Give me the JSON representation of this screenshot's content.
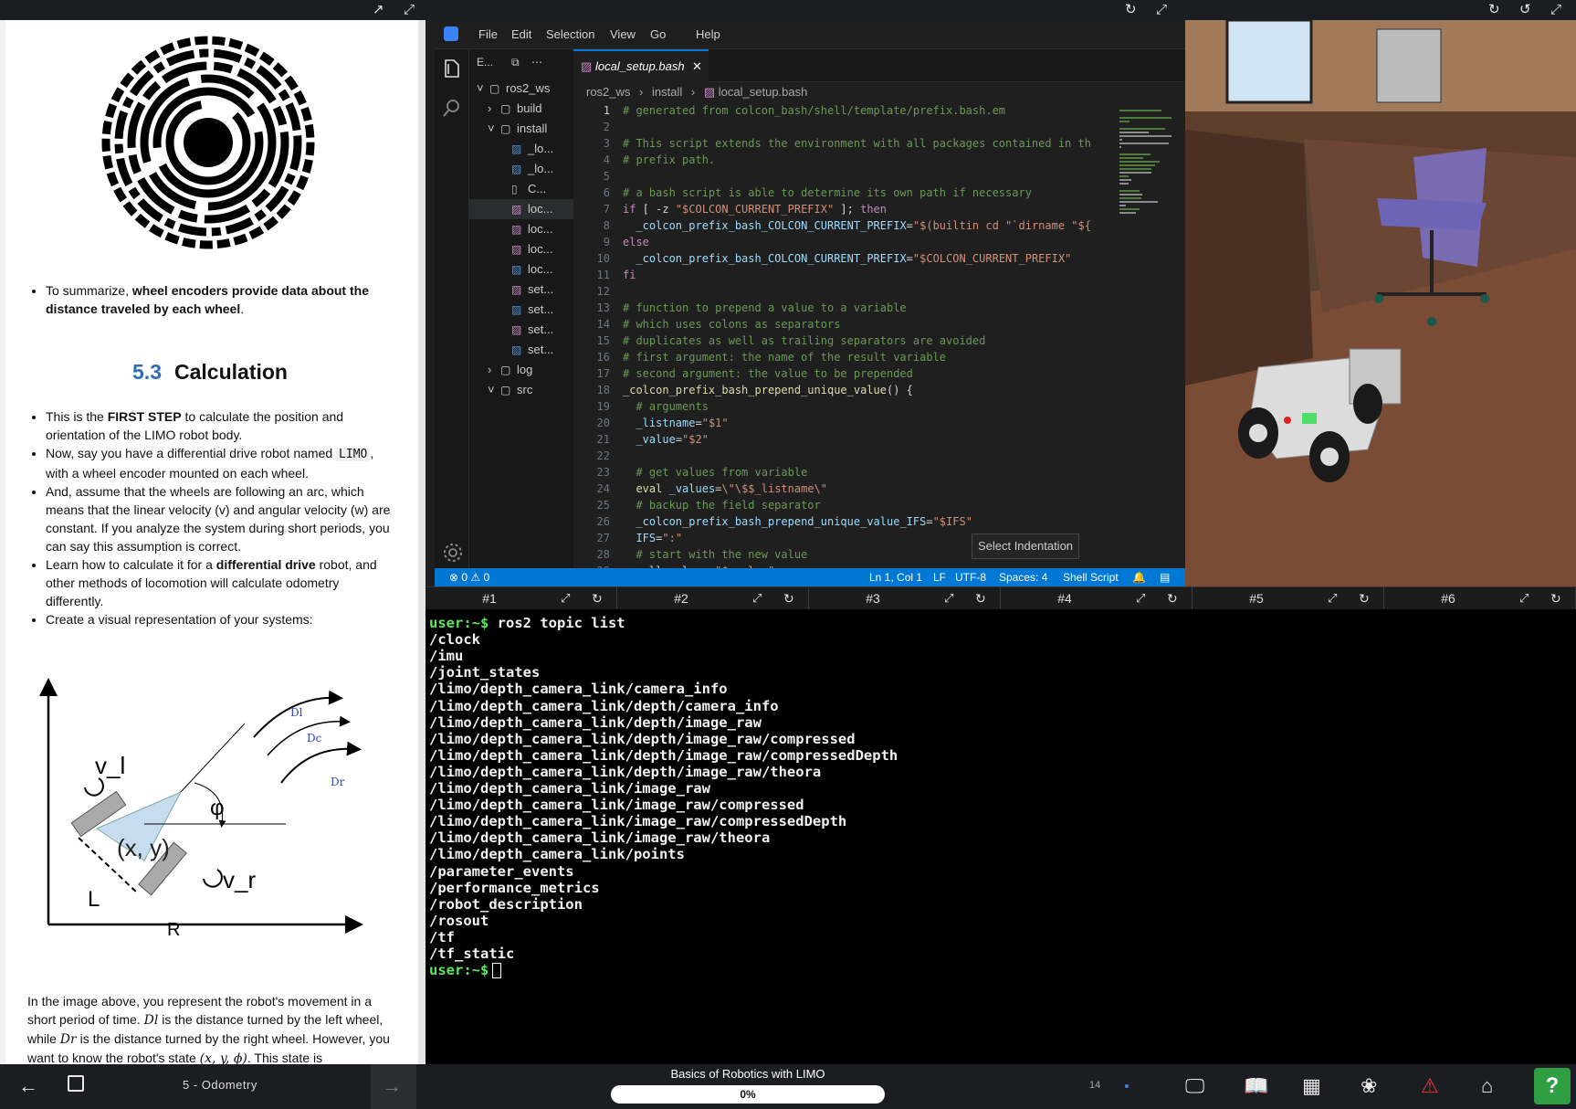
{
  "notebook": {
    "summary_bullet_prefix": "To summarize, ",
    "summary_bullet_bold": "wheel encoders provide data about the distance traveled by each wheel",
    "summary_bullet_suffix": ".",
    "section_number": "5.3",
    "section_title": "Calculation",
    "b1_prefix": "This is the ",
    "b1_bold": "FIRST STEP",
    "b1_suffix": " to calculate the position and orientation of the LIMO robot body.",
    "b2_prefix": "Now, say you have a differential drive robot named ",
    "b2_code": "LIMO",
    "b2_suffix": ", with a wheel encoder mounted on each wheel.",
    "b3": "And, assume that the wheels are following an arc, which means that the linear velocity (v) and angular velocity (w) are constant. If you analyze the system during short periods, you can say this assumption is correct.",
    "b4_prefix": "Learn how to calculate it for a ",
    "b4_bold": "differential drive",
    "b4_suffix": " robot, and other methods of locomotion will calculate odometry differently.",
    "b5": "Create a visual representation of your systems:",
    "diagram": {
      "v_l": "v_l",
      "v_r": "v_r",
      "xy": "(x, y)",
      "L": "L",
      "R": "R",
      "phi": "φ",
      "Dl": "Dl",
      "Dc": "Dc",
      "Dr": "Dr"
    },
    "para_1": "In the image above, you represent the robot's movement in a short period of time. ",
    "para_Dl": "Dl",
    "para_2": " is the distance turned by the left wheel, while ",
    "para_Dr": "Dr",
    "para_3": " is the distance turned by the right wheel. However, you want to know the robot's state ",
    "para_state": "(x, y, ϕ)",
    "para_4": ". This state is"
  },
  "vscode": {
    "menu": [
      "File",
      "Edit",
      "Selection",
      "View",
      "Go",
      "Help"
    ],
    "explorer_label": "E...",
    "tree": [
      {
        "label": "ros2_ws",
        "indent": 0,
        "type": "root",
        "open": true
      },
      {
        "label": "build",
        "indent": 1,
        "type": "folder",
        "open": false
      },
      {
        "label": "install",
        "indent": 1,
        "type": "folder",
        "open": true
      },
      {
        "label": "_lo...",
        "indent": 2,
        "type": "file-blue"
      },
      {
        "label": "_lo...",
        "indent": 2,
        "type": "file-blue"
      },
      {
        "label": "C...",
        "indent": 2,
        "type": "file-plain"
      },
      {
        "label": "loc...",
        "indent": 2,
        "type": "file-pink",
        "selected": true
      },
      {
        "label": "loc...",
        "indent": 2,
        "type": "file-pink"
      },
      {
        "label": "loc...",
        "indent": 2,
        "type": "file-pink"
      },
      {
        "label": "loc...",
        "indent": 2,
        "type": "file-blue"
      },
      {
        "label": "set...",
        "indent": 2,
        "type": "file-pink"
      },
      {
        "label": "set...",
        "indent": 2,
        "type": "file-blue"
      },
      {
        "label": "set...",
        "indent": 2,
        "type": "file-pink"
      },
      {
        "label": "set...",
        "indent": 2,
        "type": "file-blue"
      },
      {
        "label": "log",
        "indent": 1,
        "type": "folder",
        "open": false
      },
      {
        "label": "src",
        "indent": 1,
        "type": "folder",
        "open": true
      }
    ],
    "tab_label": "local_setup.bash",
    "breadcrumb": [
      "ros2_ws",
      "install",
      "local_setup.bash"
    ],
    "tooltip": "Select Indentation",
    "status": {
      "problems": "0",
      "warnings": "0",
      "position": "Ln 1, Col 1",
      "eol": "LF",
      "encoding": "UTF-8",
      "spaces": "Spaces: 4",
      "language": "Shell Script"
    }
  },
  "code_lines": [
    [
      [
        "c-com",
        "# generated from colcon_bash/shell/template/prefix.bash.em"
      ]
    ],
    [],
    [
      [
        "c-com",
        "# This script extends the environment with all packages contained in th"
      ]
    ],
    [
      [
        "c-com",
        "# prefix path."
      ]
    ],
    [],
    [
      [
        "c-com",
        "# a bash script is able to determine its own path if necessary"
      ]
    ],
    [
      [
        "c-kw",
        "if"
      ],
      [
        "c-pl",
        " [ -z "
      ],
      [
        "c-str",
        "\"$COLCON_CURRENT_PREFIX\""
      ],
      [
        "c-pl",
        " ]; "
      ],
      [
        "c-kw",
        "then"
      ]
    ],
    [
      [
        "c-pl",
        "  "
      ],
      [
        "c-var",
        "_colcon_prefix_bash_COLCON_CURRENT_PREFIX"
      ],
      [
        "c-pl",
        "="
      ],
      [
        "c-str",
        "\"$(builtin cd \"`dirname \"${"
      ]
    ],
    [
      [
        "c-kw",
        "else"
      ]
    ],
    [
      [
        "c-pl",
        "  "
      ],
      [
        "c-var",
        "_colcon_prefix_bash_COLCON_CURRENT_PREFIX"
      ],
      [
        "c-pl",
        "="
      ],
      [
        "c-str",
        "\"$COLCON_CURRENT_PREFIX\""
      ]
    ],
    [
      [
        "c-kw",
        "fi"
      ]
    ],
    [],
    [
      [
        "c-com",
        "# function to prepend a value to a variable"
      ]
    ],
    [
      [
        "c-com",
        "# which uses colons as separators"
      ]
    ],
    [
      [
        "c-com",
        "# duplicates as well as trailing separators are avoided"
      ]
    ],
    [
      [
        "c-com",
        "# first argument: the name of the result variable"
      ]
    ],
    [
      [
        "c-com",
        "# second argument: the value to be prepended"
      ]
    ],
    [
      [
        "c-fn",
        "_colcon_prefix_bash_prepend_unique_value"
      ],
      [
        "c-pl",
        "() {"
      ]
    ],
    [
      [
        "c-com",
        "  # arguments"
      ]
    ],
    [
      [
        "c-pl",
        "  "
      ],
      [
        "c-var",
        "_listname"
      ],
      [
        "c-pl",
        "="
      ],
      [
        "c-str",
        "\"$1\""
      ]
    ],
    [
      [
        "c-pl",
        "  "
      ],
      [
        "c-var",
        "_value"
      ],
      [
        "c-pl",
        "="
      ],
      [
        "c-str",
        "\"$2\""
      ]
    ],
    [],
    [
      [
        "c-com",
        "  # get values from variable"
      ]
    ],
    [
      [
        "c-pl",
        "  "
      ],
      [
        "c-fn",
        "eval"
      ],
      [
        "c-pl",
        " "
      ],
      [
        "c-var",
        "_values"
      ],
      [
        "c-pl",
        "="
      ],
      [
        "c-str",
        "\\\"\\$$_listname\\\""
      ]
    ],
    [
      [
        "c-com",
        "  # backup the field separator"
      ]
    ],
    [
      [
        "c-pl",
        "  "
      ],
      [
        "c-var",
        "_colcon_prefix_bash_prepend_unique_value_IFS"
      ],
      [
        "c-pl",
        "="
      ],
      [
        "c-str",
        "\"$IFS\""
      ]
    ],
    [
      [
        "c-pl",
        "  "
      ],
      [
        "c-var",
        "IFS"
      ],
      [
        "c-pl",
        "="
      ],
      [
        "c-str",
        "\":\""
      ]
    ],
    [
      [
        "c-com",
        "  # start with the new value"
      ]
    ],
    [
      [
        "c-pl",
        "  "
      ],
      [
        "c-var",
        "_all_values"
      ],
      [
        "c-pl",
        "="
      ],
      [
        "c-str",
        "\"$_value\""
      ]
    ]
  ],
  "terminal": {
    "tabs": [
      "#1",
      "#2",
      "#3",
      "#4",
      "#5",
      "#6"
    ],
    "prompt": "user:~$",
    "command": " ros2 topic list",
    "output": [
      "/clock",
      "/imu",
      "/joint_states",
      "/limo/depth_camera_link/camera_info",
      "/limo/depth_camera_link/depth/camera_info",
      "/limo/depth_camera_link/depth/image_raw",
      "/limo/depth_camera_link/depth/image_raw/compressed",
      "/limo/depth_camera_link/depth/image_raw/compressedDepth",
      "/limo/depth_camera_link/depth/image_raw/theora",
      "/limo/depth_camera_link/image_raw",
      "/limo/depth_camera_link/image_raw/compressed",
      "/limo/depth_camera_link/image_raw/compressedDepth",
      "/limo/depth_camera_link/image_raw/theora",
      "/limo/depth_camera_link/points",
      "/parameter_events",
      "/performance_metrics",
      "/robot_description",
      "/rosout",
      "/tf",
      "/tf_static"
    ],
    "final_prompt": "user:~$"
  },
  "bottom": {
    "unit_label": "5 - Odometry",
    "course_title": "Basics of Robotics with LIMO",
    "progress_text": "0%",
    "progress_value": 0,
    "page_number": "14",
    "help_label": "?"
  },
  "colors": {
    "accent_blue": "#0078d4",
    "section_blue": "#2f6db3",
    "prompt_green": "#5ce65c",
    "help_green": "#2ea043",
    "alert_red": "#e53935"
  }
}
